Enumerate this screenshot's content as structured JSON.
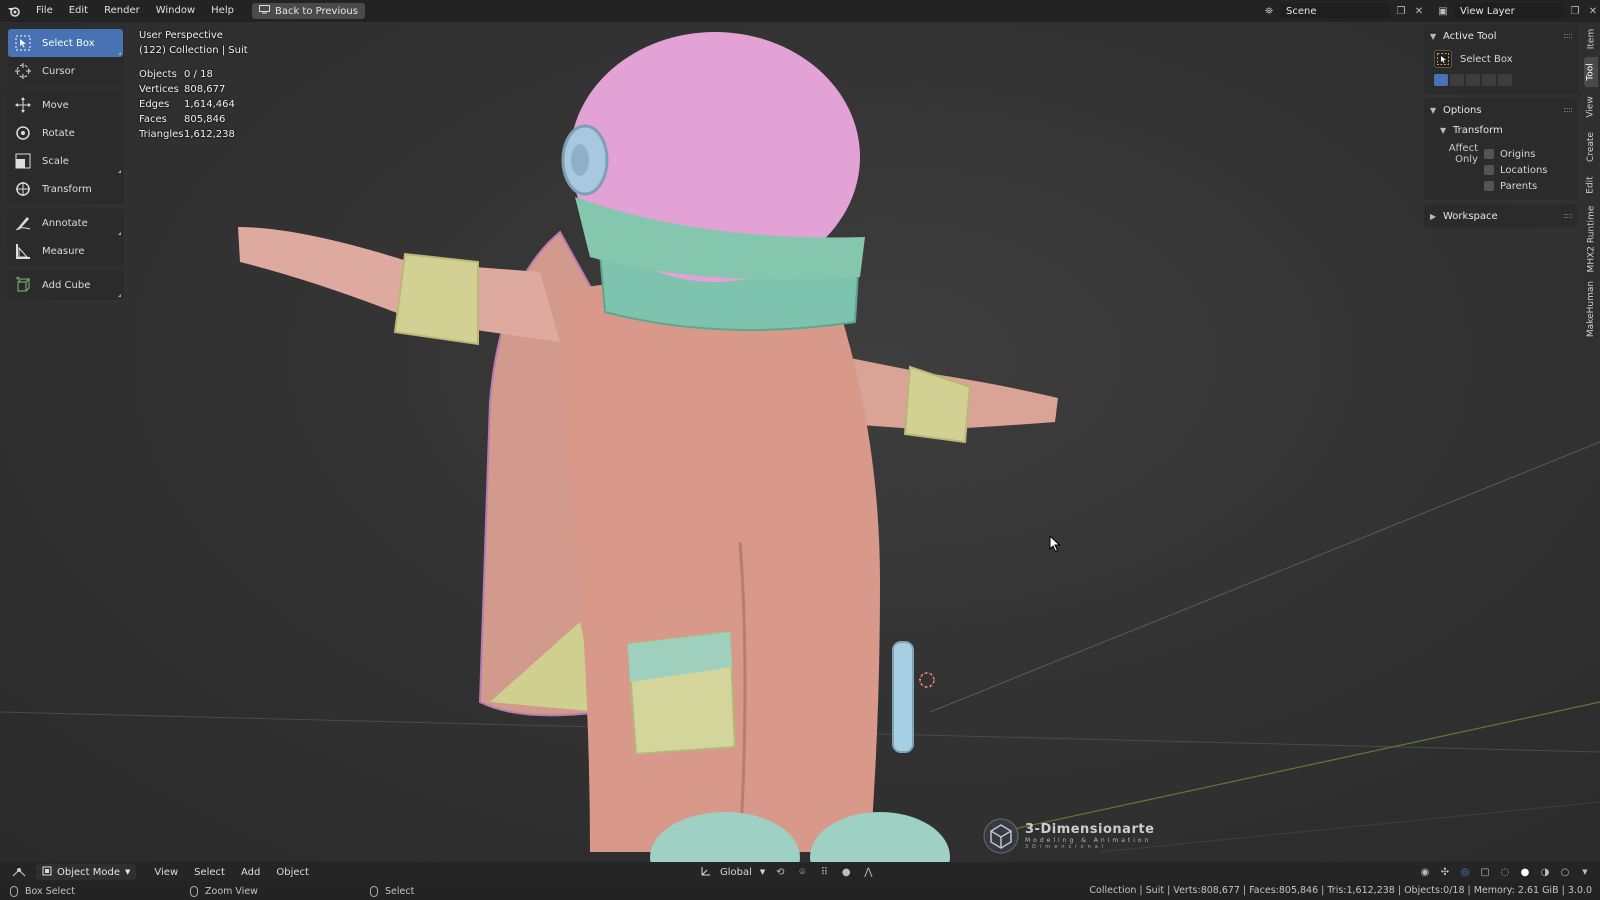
{
  "topbar": {
    "menu": [
      "File",
      "Edit",
      "Render",
      "Window",
      "Help"
    ],
    "back_label": "Back to Previous",
    "scene_name": "Scene",
    "view_layer": "View Layer"
  },
  "toolbar": {
    "tools": [
      {
        "label": "Select Box",
        "icon": "select-box-icon"
      },
      {
        "label": "Cursor",
        "icon": "cursor-icon"
      },
      {
        "label": "Move",
        "icon": "move-icon"
      },
      {
        "label": "Rotate",
        "icon": "rotate-icon"
      },
      {
        "label": "Scale",
        "icon": "scale-icon"
      },
      {
        "label": "Transform",
        "icon": "transform-icon"
      },
      {
        "label": "Annotate",
        "icon": "annotate-icon"
      },
      {
        "label": "Measure",
        "icon": "measure-icon"
      },
      {
        "label": "Add Cube",
        "icon": "add-cube-icon"
      }
    ]
  },
  "overlay": {
    "view_name": "User Perspective",
    "collection": "(122) Collection | Suit",
    "stats": [
      {
        "label": "Objects",
        "value": "0 / 18"
      },
      {
        "label": "Vertices",
        "value": "808,677"
      },
      {
        "label": "Edges",
        "value": "1,614,464"
      },
      {
        "label": "Faces",
        "value": "805,846"
      },
      {
        "label": "Triangles",
        "value": "1,612,238"
      }
    ]
  },
  "sidebar": {
    "active_tool_title": "Active Tool",
    "active_tool_name": "Select Box",
    "options_title": "Options",
    "transform_title": "Transform",
    "affect_only_label": "Affect Only",
    "affect_options": [
      "Origins",
      "Locations",
      "Parents"
    ],
    "workspace_title": "Workspace"
  },
  "vtabs": [
    "Item",
    "Tool",
    "View",
    "Create",
    "Edit",
    "MHX2 Runtime",
    "MakeHuman"
  ],
  "headerbar": {
    "mode": "Object Mode",
    "menus": [
      "View",
      "Select",
      "Add",
      "Object"
    ],
    "orientation": "Global"
  },
  "statusbar": {
    "hints": [
      "Box Select",
      "Zoom View",
      "Select"
    ],
    "info": "Collection | Suit | Verts:808,677 | Faces:805,846 | Tris:1,612,238 | Objects:0/18 | Memory: 2.61 GiB | 3.0.0"
  },
  "watermark": {
    "title": "3-Dimensionarte",
    "subtitle": "Modeling & Animation",
    "subtitle2": "3Dimensional"
  },
  "colors": {
    "accent": "#4772b3",
    "suit": "#d49a8a",
    "helmet": "#e3a0d4",
    "trim": "#7fc2ad",
    "cuff": "#c9c98a"
  }
}
